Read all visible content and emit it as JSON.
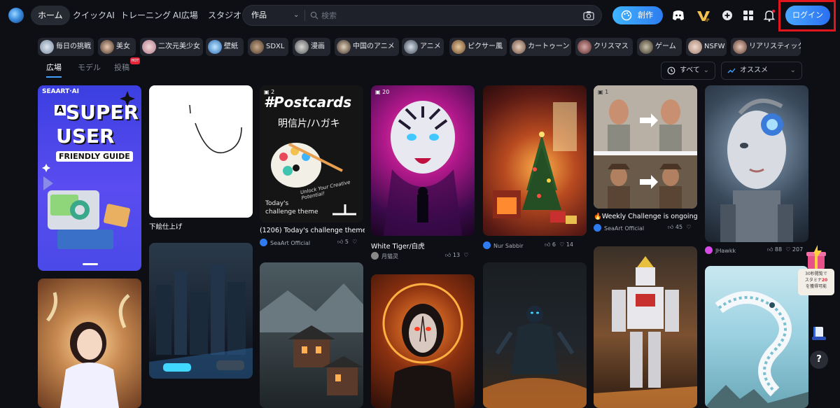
{
  "nav": {
    "items": [
      {
        "label": "ホーム",
        "active": true
      },
      {
        "label": "クイックAI",
        "active": false
      },
      {
        "label": "トレーニング",
        "active": false
      },
      {
        "label": "AI広場",
        "active": false
      },
      {
        "label": "スタジオ",
        "active": false
      }
    ],
    "search": {
      "category": "作品",
      "placeholder": "検索"
    },
    "create_label": "創作",
    "login_label": "ログイン"
  },
  "tags": [
    "毎日の挑戦",
    "美女",
    "二次元美少女",
    "壁紙",
    "SDXL",
    "漫画",
    "中国のアニメ",
    "アニメ",
    "ピクサー風",
    "カートゥーン",
    "クリスマス",
    "ゲーム",
    "NSFW",
    "リアリスティック"
  ],
  "tabs": {
    "plaza": "広場",
    "model": "モデル",
    "post": "投稿",
    "hot": "HOT"
  },
  "filters": {
    "time": "すべて",
    "sort": "オススメ"
  },
  "cards": {
    "c1": {
      "brand": "SEAART·AI",
      "line1": "A",
      "line2": "SUPER",
      "line3": "USER",
      "line4": "FRIENDLY GUIDE"
    },
    "c2": {
      "title": "下絵仕上げ"
    },
    "c3": {
      "count": "2",
      "headline": "#Postcards",
      "sub": "明信片/ハガキ",
      "script": "Unlock Your Creative Potential!",
      "footer1": "Today's",
      "footer2": "challenge theme",
      "title": "(1206) Today's challenge theme: ...",
      "author": "SeaArt Official",
      "likes": "5"
    },
    "c4": {
      "count": "20",
      "title": "White Tiger/白虎",
      "author": "月猫灵",
      "likes": "13"
    },
    "c5": {
      "author": "Nur Sabbir",
      "likes": "6",
      "favs": "14"
    },
    "c6": {
      "count": "1",
      "title": "🔥Weekly Challenge is ongoing!",
      "author": "SeaArt Official",
      "likes": "45"
    },
    "c7": {
      "author": "JHawkk",
      "likes": "88",
      "favs": "207"
    }
  },
  "side_widget": {
    "line1": "30秒閲覧で",
    "line2": "スタミナ",
    "stamina": "20",
    "line3": "を獲得可能"
  },
  "help_label": "?",
  "colors": {
    "accent": "#3fa0ff",
    "login_border": "#e0161c",
    "bg": "#0d0f14"
  }
}
